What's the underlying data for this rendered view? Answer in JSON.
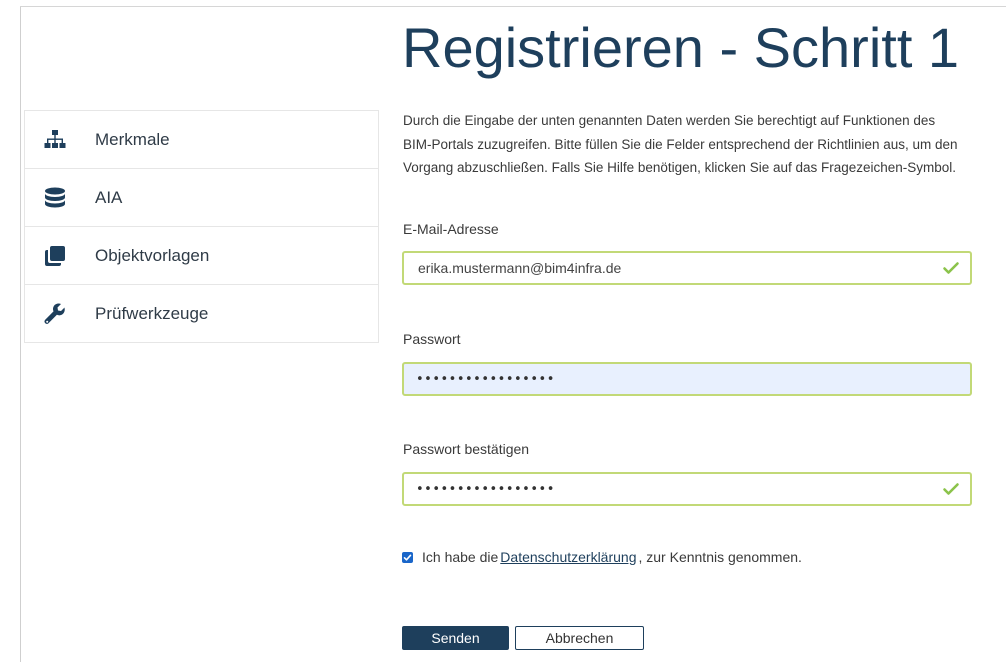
{
  "page": {
    "title": "Registrieren - Schritt 1",
    "intro": "Durch die Eingabe der unten genannten Daten werden Sie berechtigt auf Funktionen des BIM-Portals zuzugreifen. Bitte füllen Sie die Felder entsprechend der Richtlinien aus, um den Vorgang abzuschließen. Falls Sie Hilfe benötigen, klicken Sie auf das Fragezeichen-Symbol."
  },
  "sidebar": {
    "items": [
      {
        "label": "Merkmale",
        "icon": "sitemap-icon"
      },
      {
        "label": "AIA",
        "icon": "database-icon"
      },
      {
        "label": "Objektvorlagen",
        "icon": "copy-icon"
      },
      {
        "label": "Prüfwerkzeuge",
        "icon": "wrench-icon"
      }
    ]
  },
  "form": {
    "email": {
      "label": "E-Mail-Adresse",
      "value": "erika.mustermann@bim4infra.de",
      "valid": true
    },
    "password": {
      "label": "Passwort",
      "masked": "•••••••••••••••••",
      "autofilled": true
    },
    "password_confirm": {
      "label": "Passwort bestätigen",
      "masked": "•••••••••••••••••",
      "valid": true
    },
    "consent": {
      "checked": true,
      "prefix": "Ich habe die",
      "link": "Datenschutzerklärung",
      "suffix": ", zur Kenntnis genommen."
    },
    "submit_label": "Senden",
    "cancel_label": "Abbrechen"
  },
  "colors": {
    "primary": "#1e3f5c",
    "valid": "#8bc34a",
    "field_border": "#c2d977",
    "autofill_bg": "#e8f0fe",
    "checkbox": "#1a66c9"
  }
}
